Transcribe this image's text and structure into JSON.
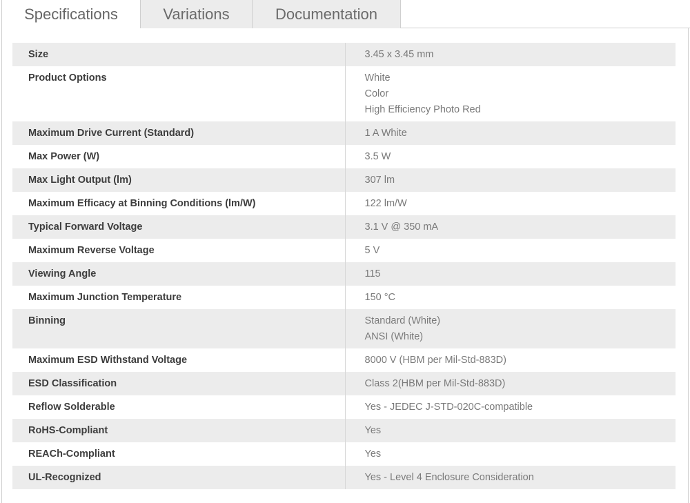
{
  "tabs": {
    "specifications": "Specifications",
    "variations": "Variations",
    "documentation": "Documentation"
  },
  "specs": [
    {
      "label": "Size",
      "values": [
        "3.45 x 3.45 mm"
      ]
    },
    {
      "label": "Product Options",
      "values": [
        "White",
        "Color",
        "High Efficiency Photo Red"
      ]
    },
    {
      "label": "Maximum Drive Current (Standard)",
      "values": [
        "1 A White"
      ]
    },
    {
      "label": "Max Power (W)",
      "values": [
        "3.5 W"
      ]
    },
    {
      "label": "Max Light Output (lm)",
      "values": [
        "307 lm"
      ]
    },
    {
      "label": "Maximum Efficacy at Binning Conditions (lm/W)",
      "values": [
        "122 lm/W"
      ]
    },
    {
      "label": "Typical Forward Voltage",
      "values": [
        "3.1 V @ 350 mA"
      ]
    },
    {
      "label": "Maximum Reverse Voltage",
      "values": [
        "5 V"
      ]
    },
    {
      "label": "Viewing Angle",
      "values": [
        "115"
      ]
    },
    {
      "label": "Maximum Junction Temperature",
      "values": [
        "150 °C"
      ]
    },
    {
      "label": "Binning",
      "values": [
        "Standard (White)",
        "ANSI (White)"
      ]
    },
    {
      "label": "Maximum ESD Withstand Voltage",
      "values": [
        "8000 V (HBM per Mil-Std-883D)"
      ]
    },
    {
      "label": "ESD Classification",
      "values": [
        "Class 2(HBM per Mil-Std-883D)"
      ]
    },
    {
      "label": "Reflow Solderable",
      "values": [
        "Yes - JEDEC J-STD-020C-compatible"
      ]
    },
    {
      "label": "RoHS-Compliant",
      "values": [
        "Yes"
      ]
    },
    {
      "label": "REACh-Compliant",
      "values": [
        "Yes"
      ]
    },
    {
      "label": "UL-Recognized",
      "values": [
        "Yes - Level 4 Enclosure Consideration"
      ]
    }
  ]
}
